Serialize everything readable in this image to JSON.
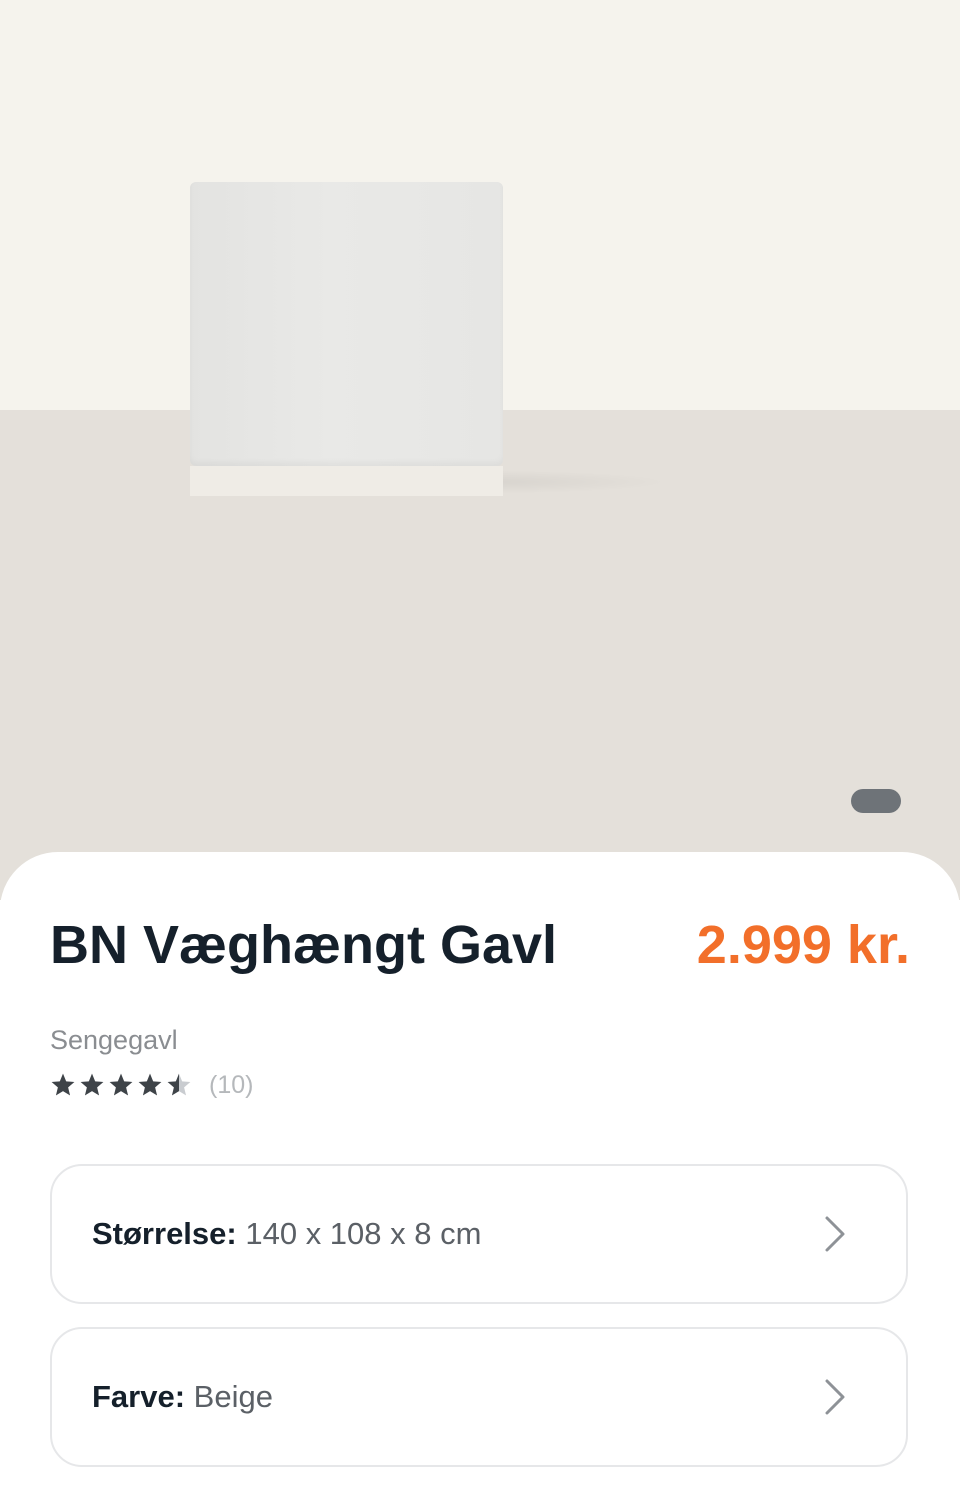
{
  "gallery": {
    "image_alt": "BN Væghængt Gavl",
    "active_slide": 1,
    "slide_count": 1
  },
  "product": {
    "title": "BN Væghængt Gavl",
    "price": "2.999 kr.",
    "category": "Sengegavl",
    "rating": {
      "value": 4.5,
      "max": 5,
      "count_label": "(10)"
    }
  },
  "options": {
    "size": {
      "label": "Størrelse:",
      "value": "140 x 108 x 8 cm"
    },
    "color": {
      "label": "Farve:",
      "value": "Beige"
    }
  },
  "colors": {
    "price": "#f26f2a",
    "title": "#15202b",
    "wall": "#f5f3ed",
    "floor": "#e4e0da",
    "star_filled": "#3e4348",
    "star_empty": "#c9ccd0"
  },
  "icons": {
    "star": "star-icon",
    "chevron": "chevron-right-icon"
  }
}
